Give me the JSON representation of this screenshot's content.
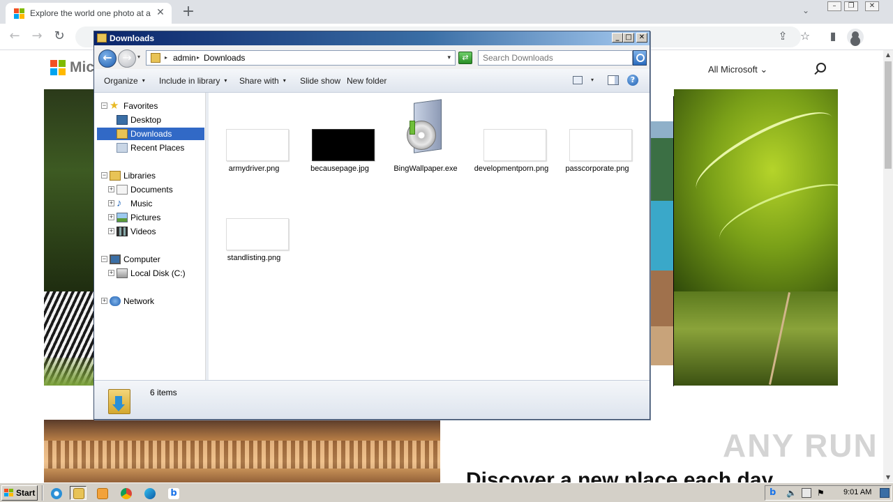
{
  "browser": {
    "tab_title": "Explore the world one photo at a time",
    "tab_close": "✕",
    "new_tab": "+",
    "tab_list": "⌄",
    "window_controls": {
      "minimize": "–",
      "restore": "❐",
      "close": "✕"
    },
    "back": "←",
    "forward": "→",
    "reload": "↻",
    "share_icon": "share-icon",
    "bookmark": "☆",
    "sidebar_icon": "▮"
  },
  "webpage": {
    "brand": "Mic",
    "all_microsoft": "All Microsoft",
    "all_microsoft_chevron": "⌄",
    "headline": "Discover a new place each day",
    "watermark": "ANY RUN",
    "scroll_up": "▲",
    "scroll_down": "▼"
  },
  "explorer": {
    "title": "Downloads",
    "title_buttons": {
      "minimize": "_",
      "maximize": "□",
      "close": "✕"
    },
    "back": "←",
    "forward": "→",
    "history": "▾",
    "breadcrumb": [
      "admin",
      "Downloads"
    ],
    "breadcrumb_sep": "▸",
    "address_dropdown": "▾",
    "refresh": "⇄",
    "search_placeholder": "Search Downloads",
    "commands": [
      {
        "label": "Organize",
        "arrow": "▾"
      },
      {
        "label": "Include in library",
        "arrow": "▾"
      },
      {
        "label": "Share with",
        "arrow": "▾"
      },
      {
        "label": "Slide show",
        "arrow": ""
      },
      {
        "label": "New folder",
        "arrow": ""
      }
    ],
    "view_dropdown": "▾",
    "help": "?",
    "nav": {
      "favorites": "Favorites",
      "desktop": "Desktop",
      "downloads": "Downloads",
      "recent_places": "Recent Places",
      "libraries": "Libraries",
      "documents": "Documents",
      "music": "Music",
      "pictures": "Pictures",
      "videos": "Videos",
      "computer": "Computer",
      "local_disk": "Local Disk (C:)",
      "network": "Network",
      "collapse": "−",
      "expand": "+"
    },
    "files": [
      {
        "name": "armydriver.png",
        "thumb": "blank"
      },
      {
        "name": "becausepage.jpg",
        "thumb": "black"
      },
      {
        "name": "BingWallpaper.exe",
        "thumb": "installer"
      },
      {
        "name": "developmentporn.png",
        "thumb": "blank"
      },
      {
        "name": "passcorporate.png",
        "thumb": "blank"
      },
      {
        "name": "standlisting.png",
        "thumb": "blank"
      }
    ],
    "status": "6 items"
  },
  "taskbar": {
    "start": "Start",
    "clock": "9:01 AM"
  },
  "colors": {
    "selection": "#3169c6",
    "titlebar_start": "#0a246a",
    "titlebar_end": "#a6caf0",
    "taskbar": "#d4d0c8"
  }
}
